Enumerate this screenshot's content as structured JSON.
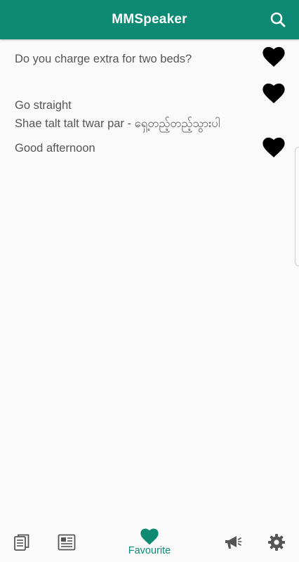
{
  "app": {
    "title": "MMSpeaker",
    "accent_color": "#0e8a74"
  },
  "favourites": [
    {
      "lines": [
        "Do you charge extra for two beds?"
      ],
      "icon": "heart-icon"
    },
    {
      "lines": [
        "Go straight",
        "Shae talt talt twar par - ရှေ့တည့်တည့်သွားပါ"
      ],
      "icon": "heart-icon"
    },
    {
      "lines": [
        "Good afternoon"
      ],
      "icon": "heart-icon"
    }
  ],
  "bottom_nav": {
    "items": [
      {
        "icon": "document-list-icon"
      },
      {
        "icon": "newspaper-icon"
      },
      {
        "icon": "heart-icon",
        "label": "Favourite",
        "active": true
      },
      {
        "icon": "megaphone-icon"
      },
      {
        "icon": "gear-icon"
      }
    ]
  }
}
